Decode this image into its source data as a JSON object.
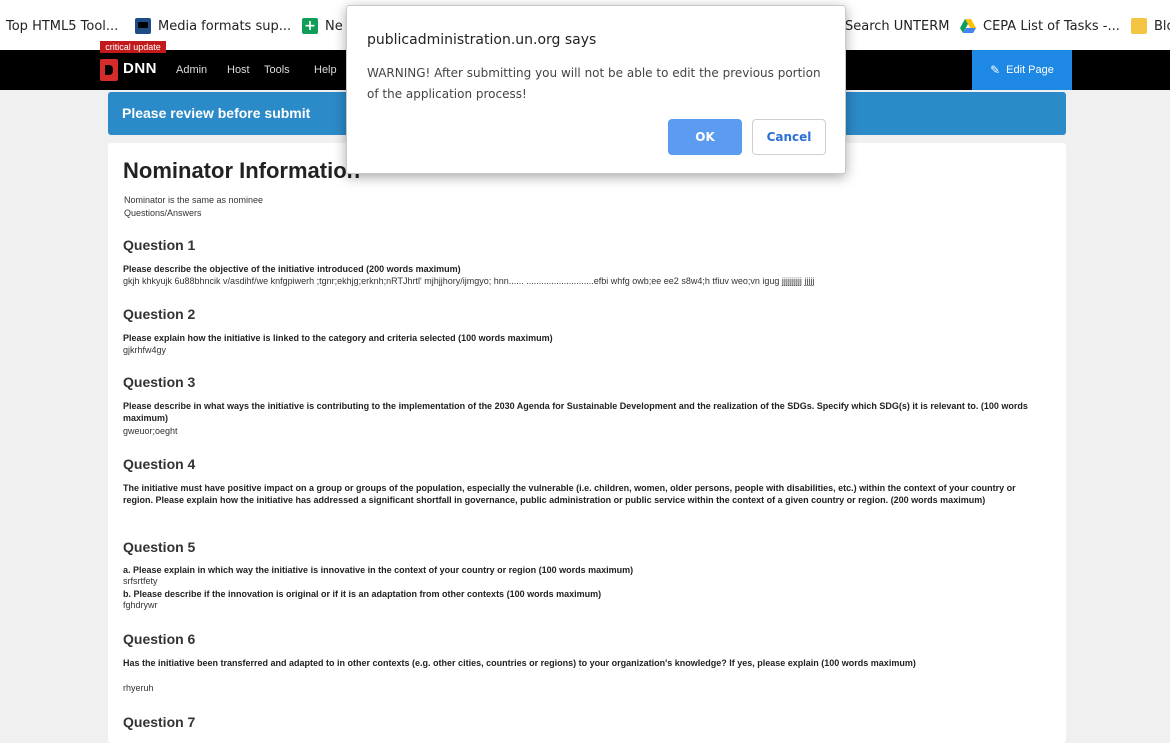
{
  "bookmarks": [
    {
      "label": "Top HTML5 Tool...",
      "icon": "none"
    },
    {
      "label": "Media formats sup...",
      "icon": "tv-icon"
    },
    {
      "label": "Ne",
      "icon": "plus-icon"
    },
    {
      "label": "Search UNTERM",
      "icon": "none"
    },
    {
      "label": "CEPA List of Tasks -...",
      "icon": "drive-icon"
    },
    {
      "label": "Blo",
      "icon": "folder-icon"
    }
  ],
  "nav": {
    "badge": "critical update",
    "logo_text": "DNN",
    "links": [
      "Admin",
      "Host",
      "Tools",
      "Help"
    ],
    "edit_page": "Edit Page"
  },
  "banner": {
    "text": "Please review before submit"
  },
  "nominator": {
    "title": "Nominator Information",
    "same_text": "Nominator is the same as nominee",
    "qa_label": "Questions/Answers"
  },
  "questions": [
    {
      "heading": "Question 1",
      "text": "Please describe the objective of the initiative introduced (200 words maximum)",
      "answer": "gkjh khkyujk 6u88bhncik v/asdihf/we knfgpiwerh ;tgnr;ekhjg;erknh;nRTJhrtl' mjhjjhory/ijmgyo; hnn...... ...........................efbi whfg owb;ee ee2 s8w4;h tfiuv weo;vn igug jjjjjjjjjj jjjjj"
    },
    {
      "heading": "Question 2",
      "text": "Please explain how the initiative is linked to the category and criteria selected (100 words maximum)",
      "answer": "gjkrhfw4gy"
    },
    {
      "heading": "Question 3",
      "text": "Please describe in what ways the initiative is contributing to the implementation of the 2030 Agenda for Sustainable Development and the realization of the SDGs. Specify which SDG(s) it is relevant to. (100 words maximum)",
      "answer": "gweuor;oeght"
    },
    {
      "heading": "Question 4",
      "text": "The initiative must have positive impact on a group or groups of the population, especially the vulnerable (i.e. children, women, older persons, people with disabilities, etc.) within the context of your country or region. Please explain how the initiative has addressed a significant shortfall in governance, public administration or public service within the context of a given country or region. (200 words maximum)",
      "answer": ""
    },
    {
      "heading": "Question 5",
      "text": "a. Please explain in which way the initiative is innovative in the context of your country or region (100 words maximum)",
      "answer": "srfsrtfety",
      "text_b": "b. Please describe if the innovation is original or if it is an adaptation from other contexts (100 words maximum)",
      "answer_b": "fghdrywr"
    },
    {
      "heading": "Question 6",
      "text": "Has the initiative been transferred and adapted to in other contexts (e.g. other cities, countries or regions) to your organization's knowledge? If yes, please explain (100 words maximum)",
      "answer": "rhyeruh"
    },
    {
      "heading": "Question 7"
    }
  ],
  "dialog": {
    "title": "publicadministration.un.org says",
    "message": "WARNING! After submitting you will not be able to edit the previous portion of the application process!",
    "ok": "OK",
    "cancel": "Cancel"
  }
}
